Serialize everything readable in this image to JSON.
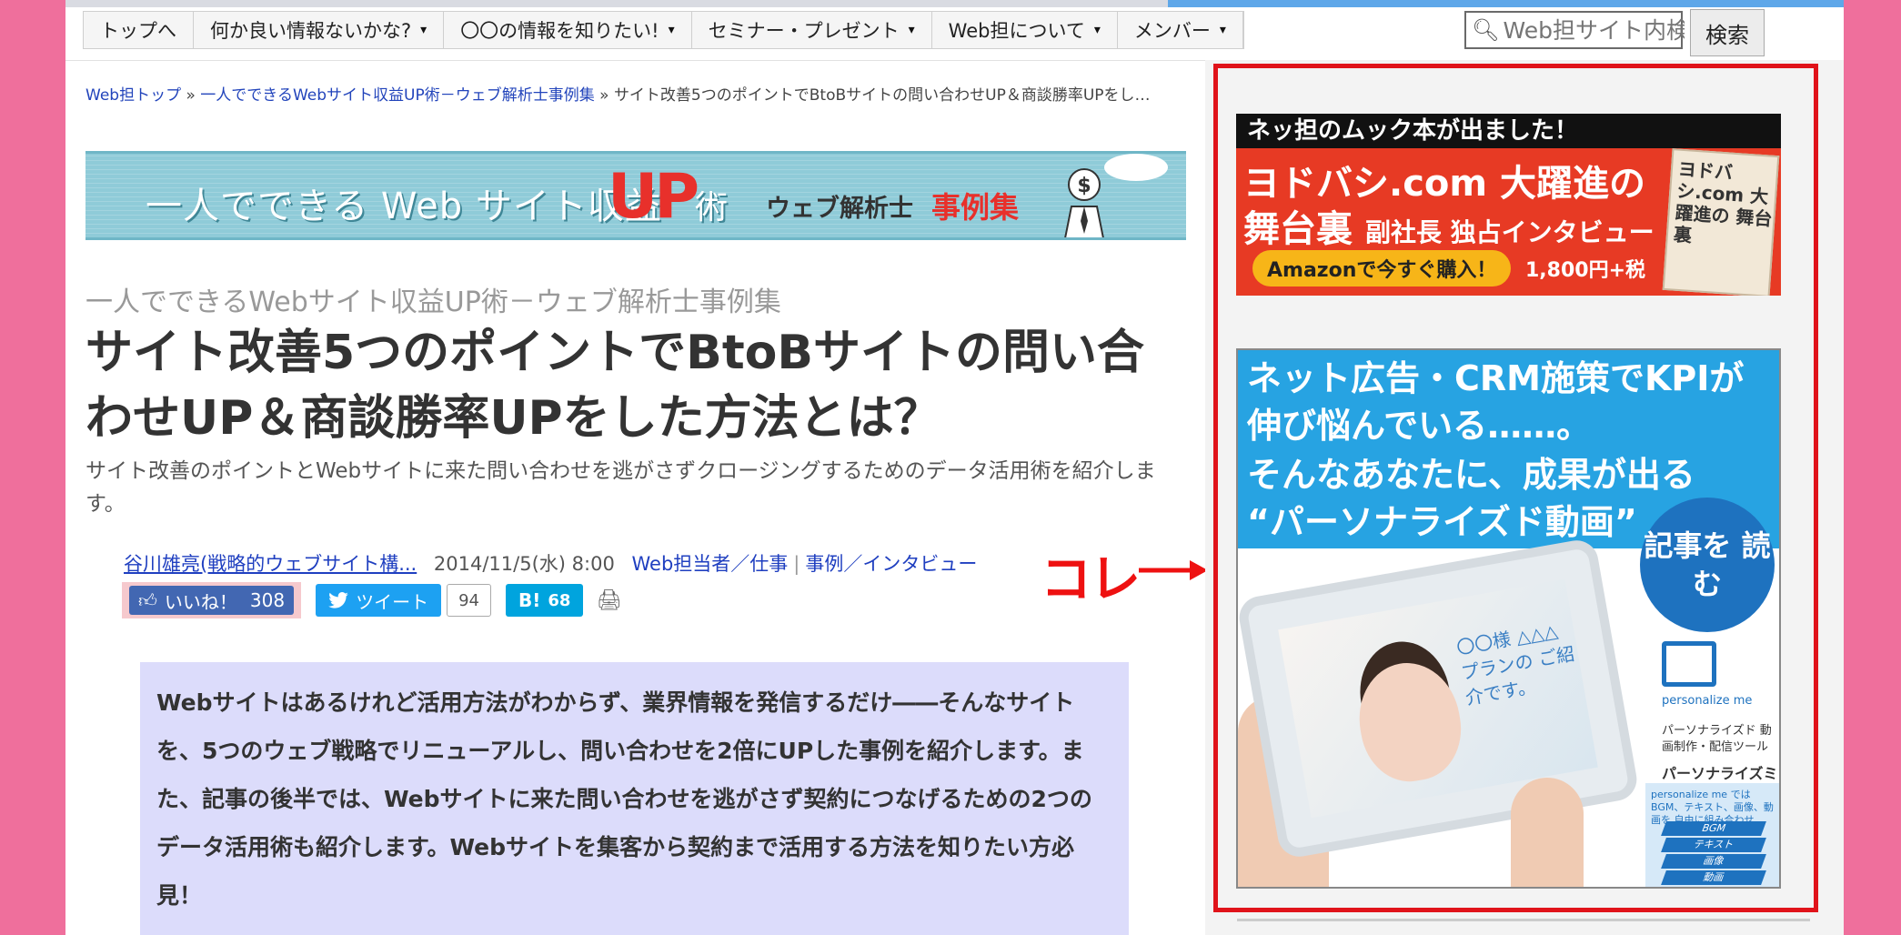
{
  "nav": {
    "items": [
      {
        "label": "トップへ",
        "has_menu": false
      },
      {
        "label": "何か良い情報ないかな?",
        "has_menu": true
      },
      {
        "label": "〇〇の情報を知りたい!",
        "has_menu": true
      },
      {
        "label": "セミナー・プレゼント",
        "has_menu": true
      },
      {
        "label": "Web担について",
        "has_menu": true
      },
      {
        "label": "メンバー",
        "has_menu": true
      }
    ],
    "menu_arrow": "▾",
    "search_placeholder": "Web担サイト内検索",
    "search_button": "検索"
  },
  "breadcrumb": {
    "items": [
      "Web担トップ",
      "一人でできるWebサイト収益UP術－ウェブ解析士事例集"
    ],
    "current": "サイト改善5つのポイントでBtoBサイトの問い合わせUP＆商談勝率UPをし…",
    "separator": "»"
  },
  "banner": {
    "text_main": "一人でできる Web サイト収益",
    "text_up": "UP",
    "text_jutsu": "術",
    "text_sub": "ウェブ解析士",
    "text_sub_red": "事例集",
    "money_symbol": "$"
  },
  "article": {
    "series": "一人でできるWebサイト収益UP術－ウェブ解析士事例集",
    "title": "サイト改善5つのポイントでBtoBサイトの問い合わせUP＆商談勝率UPをした方法とは？",
    "lead": "サイト改善のポイントとWebサイトに来た問い合わせを逃がさずクロージングするためのデータ活用術を紹介します。",
    "author": "谷川雄亮(戦略的ウェブサイト構...",
    "date": "2014/11/5(水) 8:00",
    "categories": [
      "Web担当者／仕事",
      "事例／インタビュー"
    ],
    "summary": "Webサイトはあるけれど活用方法がわからず、業界情報を発信するだけ――そんなサイトを、5つのウェブ戦略でリニューアルし、問い合わせを2倍にUPした事例を紹介します。また、記事の後半では、Webサイトに来た問い合わせを逃がさず契約につなげるための2つのデータ活用術も紹介します。Webサイトを集客から契約まで活用する方法を知りたい方必見！"
  },
  "social": {
    "like_label": "いいね！",
    "like_count": "308",
    "tweet_label": "ツイート",
    "tweet_count": "94",
    "hatena_label": "B!",
    "hatena_count": "68"
  },
  "annotation": {
    "label": "コレ",
    "color": "#e11111"
  },
  "sidebar": {
    "ad1": {
      "header": "ネッ担のムック本が出ました！",
      "line1": "ヨドバシ.com 大躍進の",
      "line2": "舞台裏",
      "line2_small": "副社長 独占インタビュー",
      "button": "Amazonで今すぐ購入！",
      "price": "1,800円+税",
      "book_title": "ヨドバシ.com 大躍進の 舞台裏"
    },
    "ad2": {
      "line1": "ネット広告・CRM施策でKPIが",
      "line2": "伸び悩んでいる……。",
      "line3": "そんなあなたに、成果が出る",
      "line4": "“パーソナライズド動画”",
      "cta": "記事を 読む",
      "screen_text": "〇〇様 △△△プランの ご紹介です。",
      "logo_text": "personalize me",
      "product_desc": "パーソナライズド 動画制作・配信ツール",
      "product_name": "パーソナライズミー",
      "features_text": "personalize me では BGM、テキスト、画像、動画を 自由に組み合わせ",
      "features": [
        "BGM",
        "テキスト",
        "画像",
        "動画"
      ]
    }
  },
  "colors": {
    "page_frame": "#ef6f9c",
    "highlight_box": "#e0131a",
    "link": "#1f3fc0",
    "summary_bg": "#dcdcfb"
  }
}
